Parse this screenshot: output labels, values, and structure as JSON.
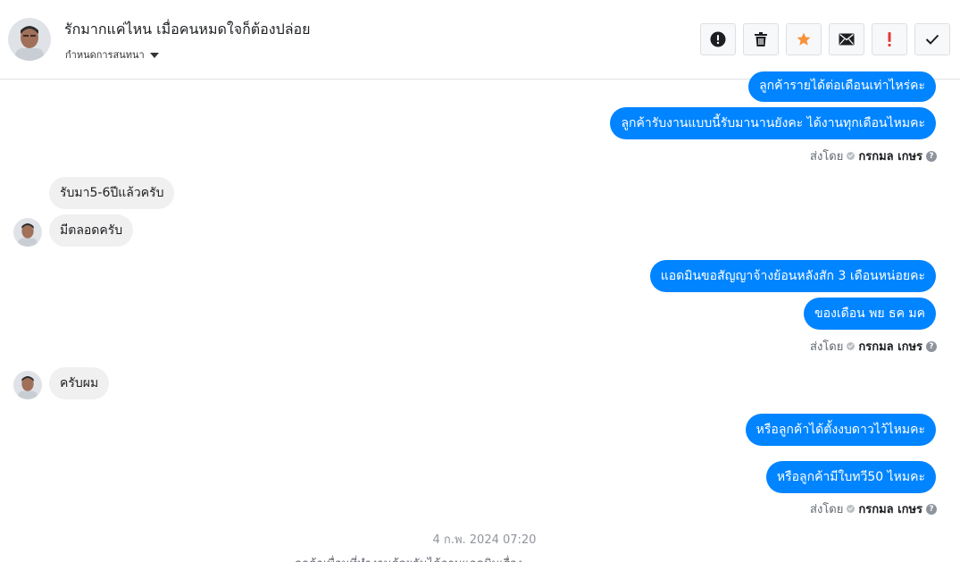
{
  "header": {
    "title": "รักมากแค่ไหน เมื่อคนหมดใจก็ต้องปล่อย",
    "subtitle": "กำหนดการสนทนา",
    "actions": [
      {
        "name": "alert-button",
        "icon": "exclamation-circle-icon"
      },
      {
        "name": "delete-button",
        "icon": "trash-icon"
      },
      {
        "name": "star-button",
        "icon": "star-icon"
      },
      {
        "name": "mail-button",
        "icon": "envelope-icon"
      },
      {
        "name": "important-button",
        "icon": "exclamation-icon"
      },
      {
        "name": "done-button",
        "icon": "check-icon"
      }
    ],
    "colors": {
      "star": "#f7923a",
      "important": "#e53935"
    }
  },
  "messages": {
    "m1": "ลูกค้ารายได้ต่อเดือนเท่าไหร่คะ",
    "m2": "ลูกค้ารับงานแบบนี้รับมานานยังคะ ได้งานทุกเดือนไหมคะ",
    "m3": "รับมา5-6ปีแล้วครับ",
    "m4": "มีตลอดครับ",
    "m5": "แอดมินขอสัญญาจ้างย้อนหลังสัก 3 เดือนหน่อยคะ",
    "m6": "ของเดือน พย ธค มค",
    "m7": "ครับผม",
    "m8": "หรือลูกค้าได้ตั้งงบดาวไว้ไหมคะ",
    "m9": "หรือลูกค้ามีใบทวี50 ไหมคะ"
  },
  "sent_by": {
    "prefix": "ส่งโดย",
    "name": "กรกมล เกษร",
    "help": "?"
  },
  "timestamp": "4 ก.พ. 2024 07:20",
  "partial_message": "ลูกค้าเพื่อนที่ทำงานด้วยกันได้ถามแอดมินเรื่อง",
  "colors": {
    "outgoing_bubble": "#0084ff",
    "incoming_bubble": "#f0f0f0"
  }
}
